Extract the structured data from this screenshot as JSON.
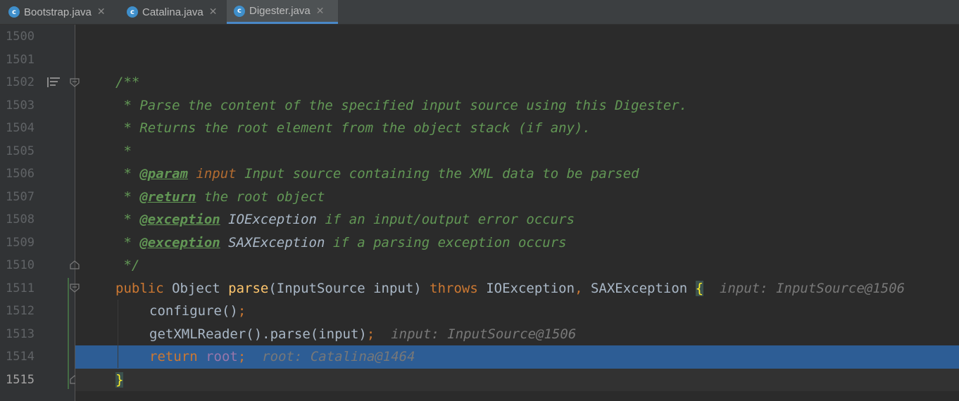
{
  "tabs": [
    {
      "label": "Bootstrap.java",
      "active": false
    },
    {
      "label": "Catalina.java",
      "active": false
    },
    {
      "label": "Digester.java",
      "active": true
    }
  ],
  "line_numbers": [
    "1500",
    "1501",
    "1502",
    "1503",
    "1504",
    "1505",
    "1506",
    "1507",
    "1508",
    "1509",
    "1510",
    "1511",
    "1512",
    "1513",
    "1514",
    "1515"
  ],
  "code": {
    "l1502": "/**",
    "l1503": " * Parse the content of the specified input source using this Digester.",
    "l1504": " * Returns the root element from the object stack (if any).",
    "l1505": " *",
    "l1506_star": " * ",
    "l1506_tag": "@param",
    "l1506_name": "input",
    "l1506_rest": " Input source containing the XML data to be parsed",
    "l1507_star": " * ",
    "l1507_tag": "@return",
    "l1507_rest": " the root object",
    "l1508_star": " * ",
    "l1508_tag": "@exception",
    "l1508_type": "IOException",
    "l1508_rest": " if an input/output error occurs",
    "l1509_star": " * ",
    "l1509_tag": "@exception",
    "l1509_type": "SAXException",
    "l1509_rest": " if a parsing exception occurs",
    "l1510": " */",
    "l1511_public": "public",
    "l1511_obj": " Object ",
    "l1511_fn": "parse",
    "l1511_args": "(InputSource input) ",
    "l1511_throws": "throws",
    "l1511_exc1": " IOException",
    "l1511_comma": ",",
    "l1511_exc2": " SAXException ",
    "l1511_brace": "{",
    "l1511_hint": "  input: InputSource@1506",
    "l1512_call": "configure()",
    "l1512_semi": ";",
    "l1513_call": "getXMLReader().parse(input)",
    "l1513_semi": ";",
    "l1513_hint": "  input: InputSource@1506",
    "l1514_return": "return",
    "l1514_root": "root",
    "l1514_semi": ";",
    "l1514_hint": "  root: Catalina@1464",
    "l1515_brace": "}"
  },
  "colors": {
    "accent": "#4a88c7",
    "highlight": "#2d5d95",
    "keyword": "#cc7832",
    "doc": "#629755"
  }
}
